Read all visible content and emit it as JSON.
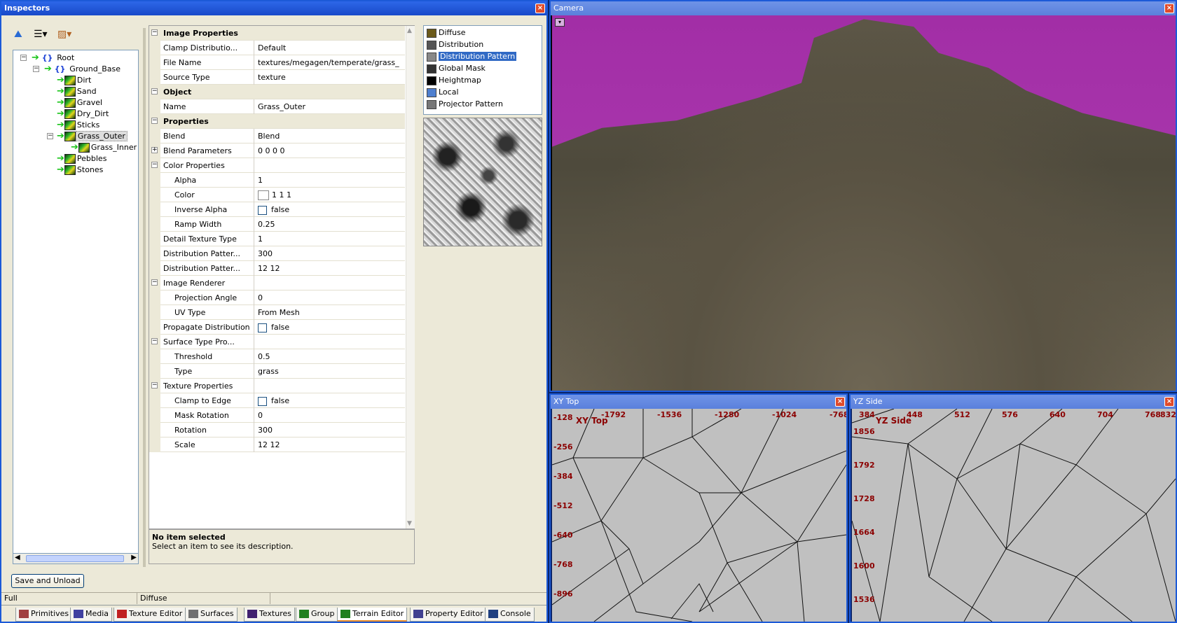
{
  "inspectors": {
    "title": "Inspectors",
    "close": "×",
    "tree": {
      "root": "Root",
      "ground_base": "Ground_Base",
      "items": [
        "Dirt",
        "Sand",
        "Gravel",
        "Dry_Dirt",
        "Sticks",
        "Grass_Outer",
        "Grass_Inner",
        "Pebbles",
        "Stones"
      ]
    },
    "props": {
      "rows": [
        {
          "type": "cat",
          "name": "Image Properties",
          "exp": "−"
        },
        {
          "type": "row",
          "name": "Clamp Distributio...",
          "val": "Default"
        },
        {
          "type": "row",
          "name": "File Name",
          "val": "textures/megagen/temperate/grass_"
        },
        {
          "type": "row",
          "name": "Source Type",
          "val": "texture"
        },
        {
          "type": "cat",
          "name": "Object",
          "exp": "−"
        },
        {
          "type": "row",
          "name": "Name",
          "val": "Grass_Outer"
        },
        {
          "type": "cat",
          "name": "Properties",
          "exp": "−"
        },
        {
          "type": "row",
          "name": "Blend",
          "val": "Blend"
        },
        {
          "type": "row",
          "name": "Blend Parameters",
          "val": "0 0 0 0",
          "exp": "+"
        },
        {
          "type": "row",
          "name": "Color Properties",
          "val": "",
          "exp": "−"
        },
        {
          "type": "sub",
          "name": "Alpha",
          "val": "1"
        },
        {
          "type": "sub",
          "name": "Color",
          "val": "1 1 1",
          "swatch": true
        },
        {
          "type": "sub",
          "name": "Inverse Alpha",
          "val": "false",
          "check": true
        },
        {
          "type": "sub",
          "name": "Ramp Width",
          "val": "0.25"
        },
        {
          "type": "row",
          "name": "Detail Texture Type",
          "val": "1"
        },
        {
          "type": "row",
          "name": "Distribution Patter...",
          "val": "300"
        },
        {
          "type": "row",
          "name": "Distribution Patter...",
          "val": "12 12"
        },
        {
          "type": "row",
          "name": "Image Renderer",
          "val": "",
          "exp": "−"
        },
        {
          "type": "sub",
          "name": "Projection Angle",
          "val": "0"
        },
        {
          "type": "sub",
          "name": "UV Type",
          "val": "From Mesh"
        },
        {
          "type": "row",
          "name": "Propagate Distribution",
          "val": "false",
          "check": true
        },
        {
          "type": "row",
          "name": "Surface Type Pro...",
          "val": "",
          "exp": "−"
        },
        {
          "type": "sub",
          "name": "Threshold",
          "val": "0.5"
        },
        {
          "type": "sub",
          "name": "Type",
          "val": "grass"
        },
        {
          "type": "row",
          "name": "Texture Properties",
          "val": "",
          "exp": "−"
        },
        {
          "type": "sub",
          "name": "Clamp to Edge",
          "val": "false",
          "check": true
        },
        {
          "type": "sub",
          "name": "Mask Rotation",
          "val": "0"
        },
        {
          "type": "sub",
          "name": "Rotation",
          "val": "300"
        },
        {
          "type": "sub",
          "name": "Scale",
          "val": "12 12"
        }
      ]
    },
    "description": {
      "title": "No item selected",
      "text": "Select an item to see its description."
    },
    "layers": [
      "Diffuse",
      "Distribution",
      "Distribution Pattern",
      "Global Mask",
      "Heightmap",
      "Local",
      "Projector Pattern"
    ],
    "selected_layer": "Distribution Pattern",
    "save_button": "Save and Unload",
    "status": {
      "left": "Full",
      "mid": "Diffuse"
    },
    "tabs": [
      "Primitives",
      "Media",
      "Texture Editor",
      "Surfaces",
      "Textures",
      "Group",
      "Terrain Editor",
      "Property Editor",
      "Console"
    ],
    "active_tab": "Terrain Editor"
  },
  "camera": {
    "title": "Camera",
    "close": "×",
    "menu": "▾"
  },
  "xy_top": {
    "title": "XY Top",
    "close": "×",
    "view_label": "XY Top",
    "x_ticks": [
      "-1792",
      "-1536",
      "-1280",
      "-1024",
      "-768"
    ],
    "y_ticks": [
      "-128",
      "-256",
      "-384",
      "-512",
      "-640",
      "-768",
      "-896"
    ]
  },
  "yz_side": {
    "title": "YZ Side",
    "close": "×",
    "view_label": "YZ Side",
    "x_ticks": [
      "384",
      "448",
      "512",
      "576",
      "640",
      "704",
      "768",
      "832"
    ],
    "y_ticks": [
      "1856",
      "1792",
      "1728",
      "1664",
      "1600",
      "1536"
    ]
  },
  "colors": {
    "titlebar": "#1849c9",
    "axis": "#8b0000",
    "sky": "#a22ea6",
    "selection": "#316ac5"
  }
}
